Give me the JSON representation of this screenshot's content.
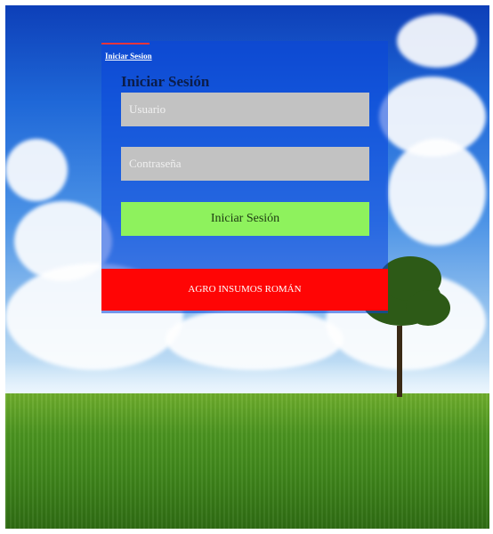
{
  "login": {
    "tab_label": "Iniciar Sesion",
    "title": "Iniciar Sesión",
    "username_placeholder": "Usuario",
    "password_placeholder": "Contraseña",
    "submit_label": "Iniciar Sesión"
  },
  "brand": {
    "name": "AGRO INSUMOS ROMÁN"
  },
  "colors": {
    "panel": "#0a46dc",
    "tab_underline": "#e8353b",
    "input_bg": "#c2c2c2",
    "submit_bg": "#8ef25d",
    "brand_bar": "#ff0505"
  }
}
